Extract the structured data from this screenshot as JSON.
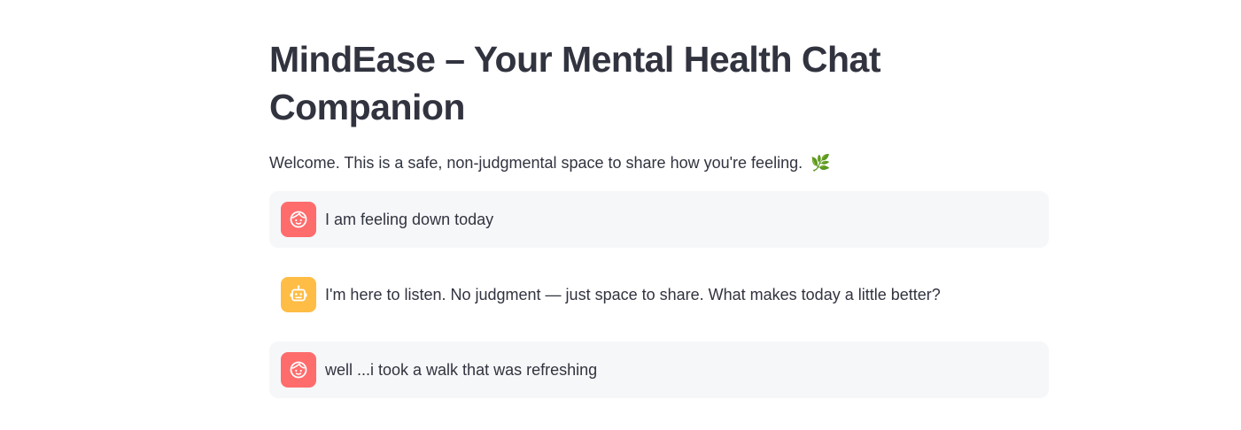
{
  "header": {
    "title": "MindEase – Your Mental Health Chat Companion",
    "welcome": "Welcome. This is a safe, non-judgmental space to share how you're feeling.",
    "welcome_emoji": "🌿"
  },
  "colors": {
    "user_avatar": "#ff6c6c",
    "assistant_avatar": "#ffbd45",
    "user_bubble": "#f6f7f9",
    "text": "#31333f"
  },
  "chat": {
    "messages": [
      {
        "role": "user",
        "avatar_icon": "user-face-icon",
        "text": "I am feeling down today"
      },
      {
        "role": "assistant",
        "avatar_icon": "robot-icon",
        "text": "I'm here to listen. No judgment — just space to share. What makes today a little better?"
      },
      {
        "role": "user",
        "avatar_icon": "user-face-icon",
        "text": "well ...i took a walk that was refreshing"
      }
    ]
  }
}
